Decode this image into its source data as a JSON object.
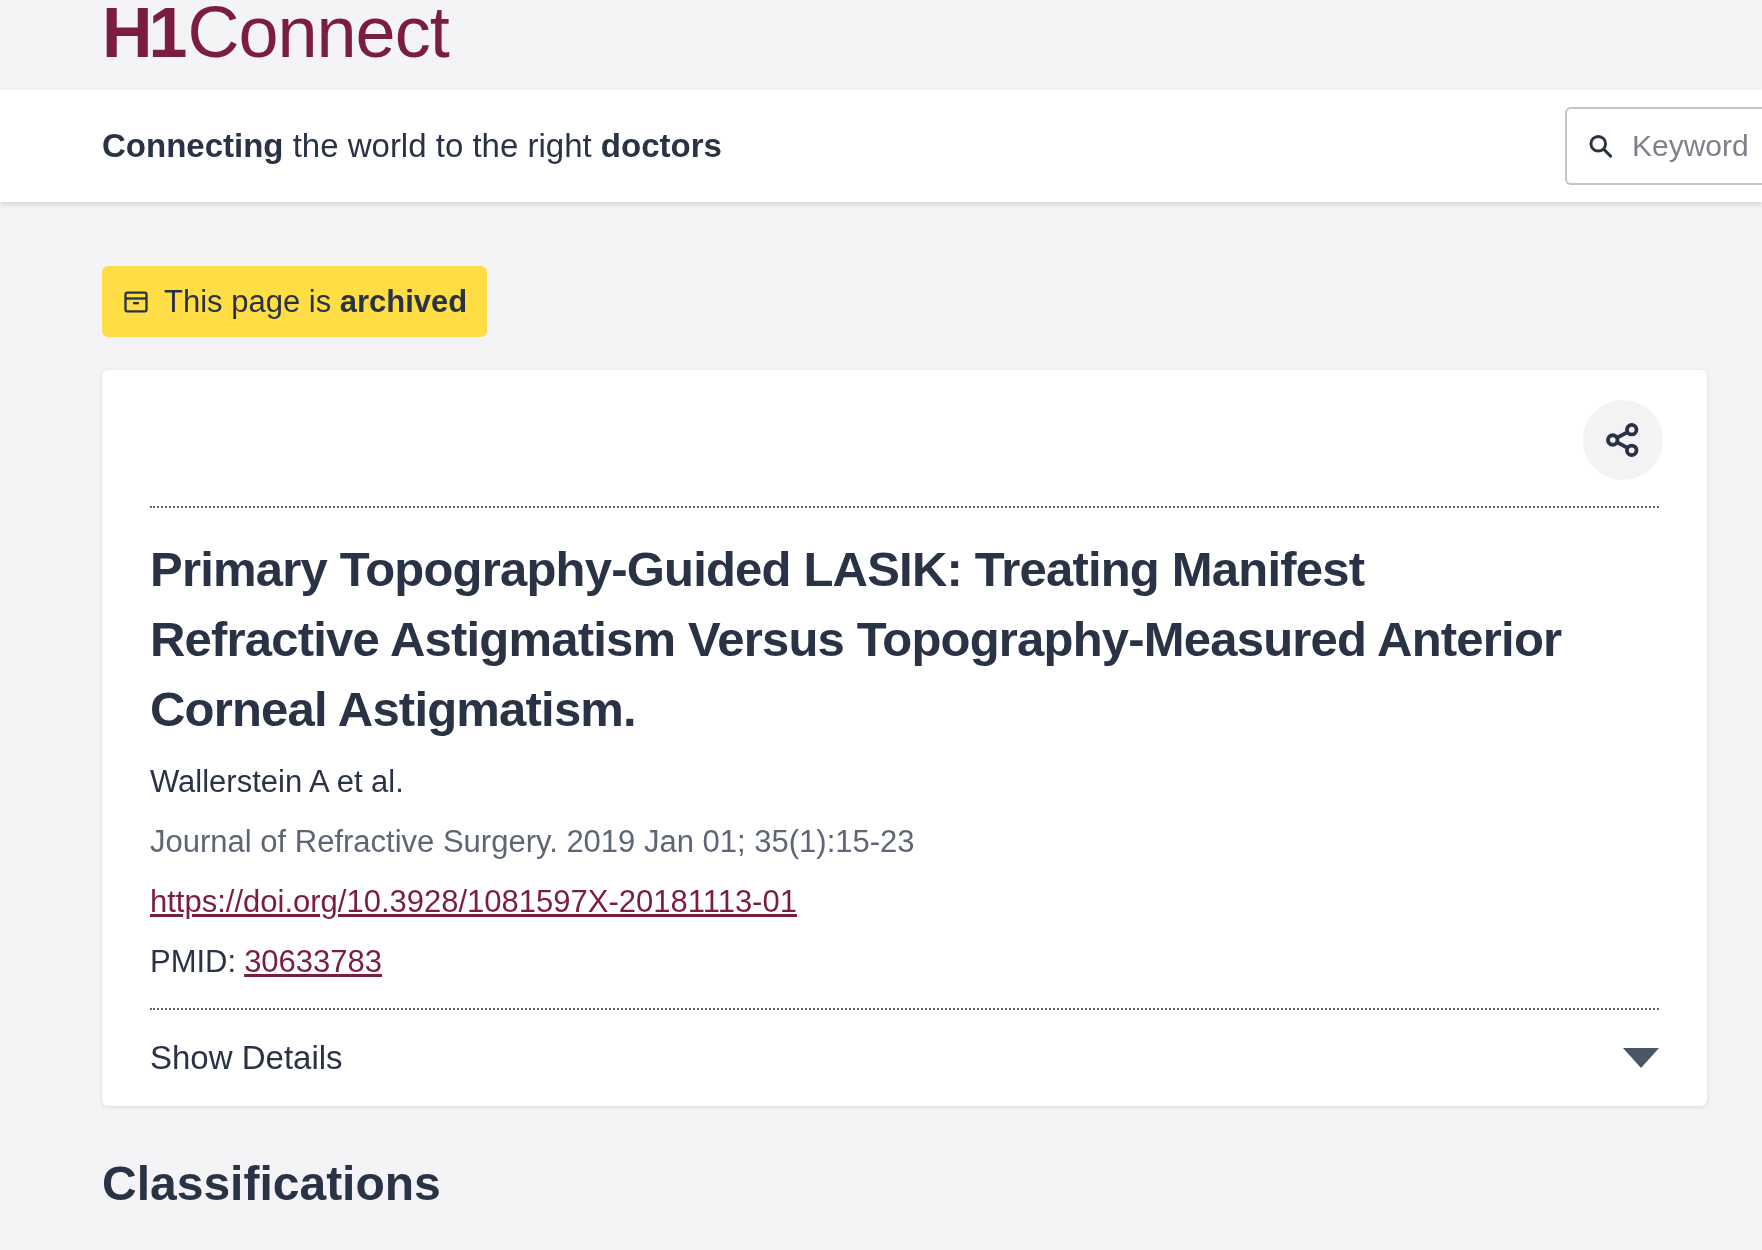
{
  "header": {
    "logo": {
      "mark": "H1",
      "name": "Connect"
    },
    "tagline": "**Connecting** the world to the right **doctors**",
    "search": {
      "placeholder": "Keyword"
    }
  },
  "archive_notice": "This page is **archived**",
  "article": {
    "title": "Primary Topography-Guided LASIK: Treating Manifest Refractive Astigmatism Versus Topography-Measured Anterior Corneal Astigmatism.",
    "authors": "Wallerstein A et al.",
    "citation": "Journal of Refractive Surgery. 2019 Jan 01; 35(1):15-23",
    "doi": "https://doi.org/10.3928/1081597X-20181113-01",
    "pmid_label": "PMID:",
    "pmid": "30633783",
    "details": {
      "label": "Show Details",
      "expanded": false
    }
  },
  "section_heading": "Classifications"
}
